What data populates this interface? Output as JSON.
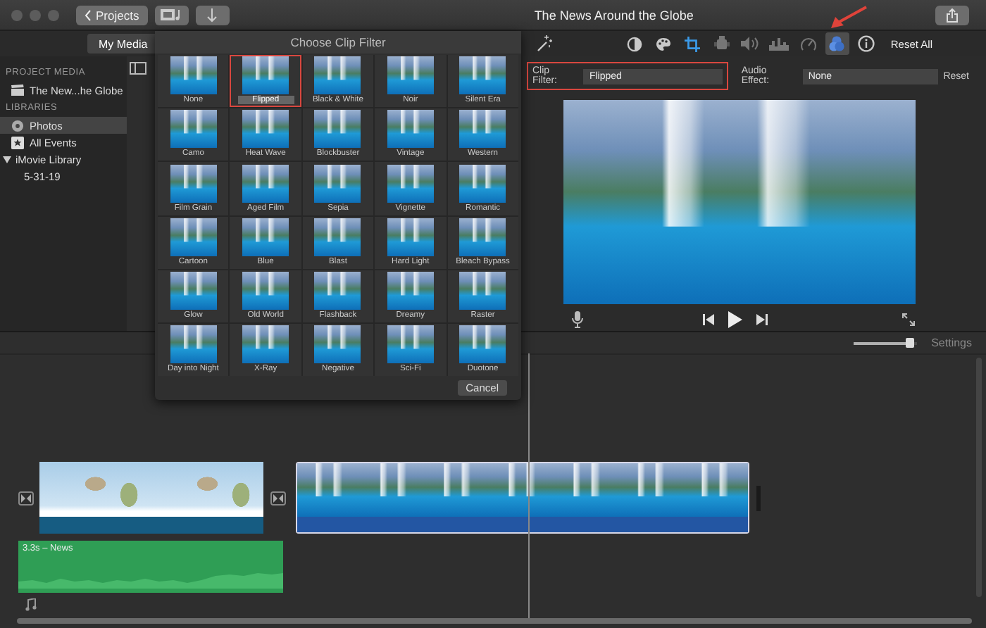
{
  "window": {
    "title": "The News Around the Globe",
    "back_button": "Projects"
  },
  "media_tab": {
    "label": "My Media",
    "selected": true
  },
  "sidebar": {
    "sections": [
      {
        "heading": "PROJECT MEDIA",
        "items": [
          {
            "label": "The New...he Globe",
            "kind": "project",
            "selected": false
          }
        ]
      },
      {
        "heading": "LIBRARIES",
        "items": [
          {
            "label": "Photos",
            "kind": "photos",
            "selected": true
          },
          {
            "label": "All Events",
            "kind": "events",
            "selected": false
          },
          {
            "label": "iMovie Library",
            "selected": false,
            "expanded": true,
            "children": [
              {
                "label": "5-31-19",
                "selected": false
              }
            ]
          }
        ]
      }
    ]
  },
  "filter_popover": {
    "title": "Choose Clip Filter",
    "cancel": "Cancel",
    "filters": [
      {
        "label": "None",
        "selected": false
      },
      {
        "label": "Flipped",
        "selected": true
      },
      {
        "label": "Black & White",
        "selected": false
      },
      {
        "label": "Noir",
        "selected": false
      },
      {
        "label": "Silent Era",
        "selected": false
      },
      {
        "label": "Camo",
        "selected": false
      },
      {
        "label": "Heat Wave",
        "selected": false
      },
      {
        "label": "Blockbuster",
        "selected": false
      },
      {
        "label": "Vintage",
        "selected": false
      },
      {
        "label": "Western",
        "selected": false
      },
      {
        "label": "Film Grain",
        "selected": false
      },
      {
        "label": "Aged Film",
        "selected": false
      },
      {
        "label": "Sepia",
        "selected": false
      },
      {
        "label": "Vignette",
        "selected": false
      },
      {
        "label": "Romantic",
        "selected": false
      },
      {
        "label": "Cartoon",
        "selected": false
      },
      {
        "label": "Blue",
        "selected": false
      },
      {
        "label": "Blast",
        "selected": false
      },
      {
        "label": "Hard Light",
        "selected": false
      },
      {
        "label": "Bleach Bypass",
        "selected": false
      },
      {
        "label": "Glow",
        "selected": false
      },
      {
        "label": "Old World",
        "selected": false
      },
      {
        "label": "Flashback",
        "selected": false
      },
      {
        "label": "Dreamy",
        "selected": false
      },
      {
        "label": "Raster",
        "selected": false
      },
      {
        "label": "Day into Night",
        "selected": false
      },
      {
        "label": "X-Ray",
        "selected": false
      },
      {
        "label": "Negative",
        "selected": false
      },
      {
        "label": "Sci-Fi",
        "selected": false
      },
      {
        "label": "Duotone",
        "selected": false
      }
    ]
  },
  "inspector": {
    "tools": [
      {
        "kind": "color-balance",
        "selected": false
      },
      {
        "kind": "color-correction",
        "selected": false
      },
      {
        "kind": "crop",
        "selected": false
      },
      {
        "kind": "stabilization",
        "selected": false
      },
      {
        "kind": "volume",
        "selected": false
      },
      {
        "kind": "noise-reduction",
        "selected": false
      },
      {
        "kind": "speed",
        "selected": false
      },
      {
        "kind": "clip-filter",
        "selected": true
      },
      {
        "kind": "info",
        "selected": false
      }
    ],
    "reset_all": "Reset All",
    "clip_filter": {
      "label": "Clip Filter:",
      "value": "Flipped",
      "highlighted": true
    },
    "audio_effect": {
      "label": "Audio Effect:",
      "value": "None"
    },
    "reset": "Reset"
  },
  "timeline": {
    "settings": "Settings",
    "zoom": {
      "level": 0.88
    },
    "clips": [
      {
        "kind": "map"
      },
      {
        "kind": "waterfall"
      }
    ],
    "audio_clip": {
      "label": "3.3s – News"
    }
  }
}
